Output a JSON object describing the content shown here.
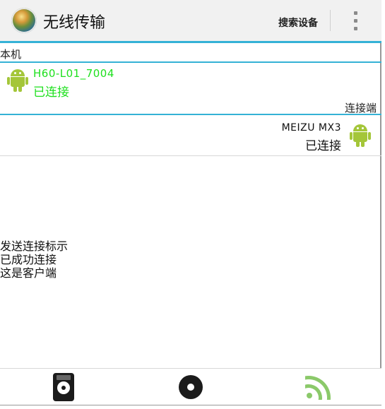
{
  "app": {
    "title": "无线传输",
    "search_button": "搜索设备",
    "accent_color": "#35b2d6"
  },
  "local": {
    "section_label": "本机",
    "device_name": "H60-L01_7004",
    "status": "已连接",
    "icon": "android-icon",
    "status_color": "#1de01d"
  },
  "client": {
    "section_label": "连接端",
    "device_name": "MEIZU MX3",
    "status": "已连接",
    "icon": "android-icon"
  },
  "log": {
    "lines": [
      "发送连接标示",
      "已成功连接",
      "这是客户端"
    ]
  },
  "bottom_tabs": [
    {
      "name": "music-player-icon"
    },
    {
      "name": "record-disc-icon"
    },
    {
      "name": "wireless-signal-icon",
      "active": true
    }
  ]
}
